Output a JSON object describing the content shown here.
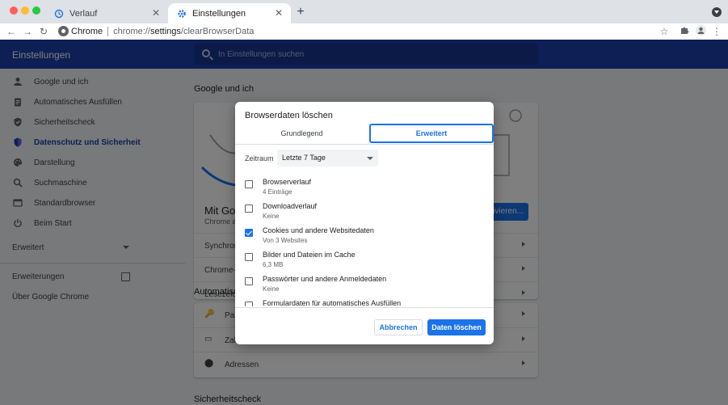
{
  "browser": {
    "tabs": [
      {
        "label": "Verlauf",
        "icon": "history-icon"
      },
      {
        "label": "Einstellungen",
        "icon": "gear-icon"
      }
    ],
    "omnibox": {
      "chip": "Chrome",
      "url_prefix": "chrome://",
      "url_bold": "settings",
      "url_suffix": "/clearBrowserData"
    }
  },
  "header": {
    "title": "Einstellungen",
    "search_placeholder": "In Einstellungen suchen"
  },
  "sidebar": {
    "items": [
      {
        "label": "Google und ich",
        "icon": "person-icon"
      },
      {
        "label": "Automatisches Ausfüllen",
        "icon": "clipboard-icon"
      },
      {
        "label": "Sicherheitscheck",
        "icon": "shield-check-icon"
      },
      {
        "label": "Datenschutz und Sicherheit",
        "icon": "shield-icon",
        "active": true
      },
      {
        "label": "Darstellung",
        "icon": "palette-icon"
      },
      {
        "label": "Suchmaschine",
        "icon": "search-icon"
      },
      {
        "label": "Standardbrowser",
        "icon": "browser-icon"
      },
      {
        "label": "Beim Start",
        "icon": "power-icon"
      }
    ],
    "advanced": "Erweitert",
    "extensions": "Erweiterungen",
    "about": "Über Google Chrome"
  },
  "main": {
    "section_google": "Google und ich",
    "sync_heading": "Mit Goo",
    "sync_sub": "Chrome a",
    "sync_button": "ivieren...",
    "rows_google": [
      "Synchroni",
      "Chrome-Pr",
      "Lesezeich"
    ],
    "section_autofill": "Automatisch",
    "rows_autofill": [
      "Pas",
      "Zah",
      "Adressen"
    ],
    "section_safety": "Sicherheitscheck"
  },
  "dialog": {
    "title": "Browserdaten löschen",
    "tab_basic": "Grundlegend",
    "tab_advanced": "Erweitert",
    "range_label": "Zeitraum",
    "range_value": "Letzte 7 Tage",
    "options": [
      {
        "label": "Browserverlauf",
        "sub": "4 Einträge",
        "checked": false
      },
      {
        "label": "Downloadverlauf",
        "sub": "Keine",
        "checked": false
      },
      {
        "label": "Cookies und andere Websitedaten",
        "sub": "Von 3 Websites",
        "checked": true
      },
      {
        "label": "Bilder und Dateien im Cache",
        "sub": "6,3 MB",
        "checked": false
      },
      {
        "label": "Passwörter und andere Anmeldedaten",
        "sub": "Keine",
        "checked": false
      },
      {
        "label": "Formulardaten für automatisches Ausfüllen",
        "sub": "",
        "checked": false
      }
    ],
    "cancel": "Abbrechen",
    "confirm": "Daten löschen"
  },
  "colors": {
    "header": "#1a3ea8",
    "accent": "#1a73e8"
  }
}
